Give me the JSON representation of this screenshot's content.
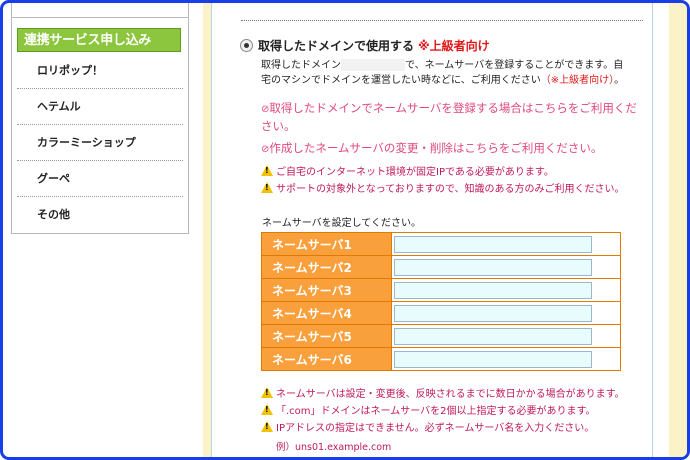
{
  "sidebar": {
    "heading": "連携サービス申し込み",
    "items": [
      {
        "label": "ロリポップ！"
      },
      {
        "label": "ヘテムル"
      },
      {
        "label": "カラーミーショップ"
      },
      {
        "label": "グーペ"
      },
      {
        "label": "その他"
      }
    ]
  },
  "option": {
    "title": "取得したドメインで使用する",
    "advanced": "※上級者向け",
    "desc_part1": "取得したドメイン",
    "desc_part2": "で、ネームサーバを登録することができます。自",
    "desc_part3": "宅のマシンでドメインを運営したい時などに、ご利用ください",
    "desc_advanced": "（※上級者向け）",
    "desc_end": "。"
  },
  "links": [
    {
      "icon": "arrow-icon",
      "text": "取得したドメインでネームサーバを登録する場合はこちらをご利用ください。"
    },
    {
      "icon": "arrow-icon",
      "text": "作成したネームサーバの変更・削除はこちらをご利用ください。"
    }
  ],
  "warnings": [
    "ご自宅のインターネット環境が固定IPである必要があります。",
    "サポートの対象外となっておりますので、知識のある方のみご利用ください。"
  ],
  "ns_prompt": "ネームサーバを設定してください。",
  "nameservers": [
    {
      "label": "ネームサーバ1",
      "value": ""
    },
    {
      "label": "ネームサーバ2",
      "value": ""
    },
    {
      "label": "ネームサーバ3",
      "value": ""
    },
    {
      "label": "ネームサーバ4",
      "value": ""
    },
    {
      "label": "ネームサーバ5",
      "value": ""
    },
    {
      "label": "ネームサーバ6",
      "value": ""
    }
  ],
  "notes": [
    "ネームサーバは設定・変更後、反映されるまでに数日かかる場合があります。",
    "「.com」ドメインはネームサーバを2個以上指定する必要があります。",
    "IPアドレスの指定はできません。必ずネームサーバ名を入力ください。"
  ],
  "example": "例）uns01.example.com",
  "colors": {
    "frame": "#1a3ee6",
    "sidebar_heading": "#8cc63e",
    "table_header": "#f9a03c",
    "warning": "#c0185a",
    "link": "#e0487c",
    "advanced": "#e01818"
  }
}
